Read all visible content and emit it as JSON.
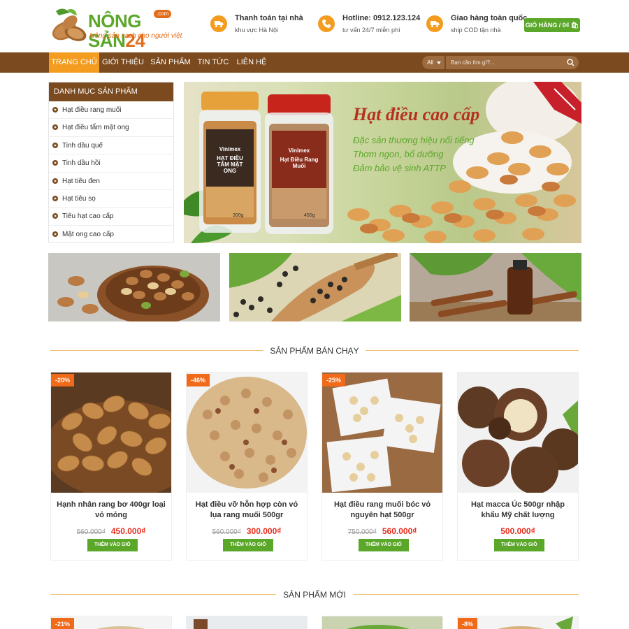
{
  "brand": {
    "name_a": "NÔNG SẢN",
    "name_b": "24",
    "com": ".com",
    "slogan": "Nông sản sạch cho người việt"
  },
  "header_info": [
    {
      "title": "Thanh toán tại nhà",
      "sub": "khu vực Hà Nội",
      "icon": "truck-icon"
    },
    {
      "title": "Hotline: 0912.123.124",
      "sub": "tư vấn 24/7 miễn phí",
      "icon": "phone-icon"
    },
    {
      "title": "Giao hàng toàn quốc",
      "sub": "ship COD tận nhà",
      "icon": "truck-icon"
    }
  ],
  "cart_label": "GIỎ HÀNG / 0₫",
  "nav": {
    "items": [
      "TRANG CHỦ",
      "GIỚI THIỆU",
      "SẢN PHẨM",
      "TIN TỨC",
      "LIÊN HỆ"
    ],
    "select_value": "All",
    "search_placeholder": "Bạn cần tìm gì?..."
  },
  "categories": {
    "title": "DANH MỤC SẢN PHẨM",
    "items": [
      "Hạt điều rang muối",
      "Hạt điều tẩm mật ong",
      "Tinh dầu quế",
      "Tinh dầu hồi",
      "Hạt tiêu đen",
      "Hạt tiêu sọ",
      "Tiêu hạt cao cấp",
      "Mật ong cao cấp"
    ]
  },
  "banner": {
    "title": "Hạt điều cao cấp",
    "lines": [
      "Đặc sản thương hiệu nổi tiếng",
      "Thơm ngon, bổ dưỡng",
      "Đảm bảo vệ sinh ATTP"
    ],
    "jar1_brand": "Vinimex",
    "jar1_label": "HẠT ĐIỀU TẨM MẬT ONG",
    "jar1_weight": "300g",
    "jar2_brand": "Vinimex",
    "jar2_label": "Hạt Điều Rang Muối",
    "jar2_weight": "450g"
  },
  "best_sellers": {
    "title": "SẢN PHẨM BÁN CHẠY",
    "products": [
      {
        "badge": "-20%",
        "name": "Hạnh nhân rang bơ 400gr loại vỏ mỏng",
        "old_price": "560.000₫",
        "price": "450.000₫"
      },
      {
        "badge": "-46%",
        "name": "Hạt điều vỡ hỗn hợp còn vỏ lụa rang muối 500gr",
        "old_price": "560.000₫",
        "price": "300.000₫"
      },
      {
        "badge": "-25%",
        "name": "Hạt điều rang muối bóc vỏ nguyên hạt 500gr",
        "old_price": "750.000₫",
        "price": "560.000₫"
      },
      {
        "badge": "",
        "name": "Hạt macca Úc 500gr nhập khẩu Mỹ chất lượng",
        "old_price": "",
        "price": "500.000₫"
      }
    ],
    "add_label": "THÊM VÀO GIỎ"
  },
  "new_products": {
    "title": "SẢN PHẨM MỚI",
    "badges": [
      "-21%",
      "",
      "",
      "-8%"
    ]
  },
  "colors": {
    "brown": "#7b4a1e",
    "orange": "#f39c1f",
    "green": "#5ba72a",
    "red": "#e62e1e"
  }
}
